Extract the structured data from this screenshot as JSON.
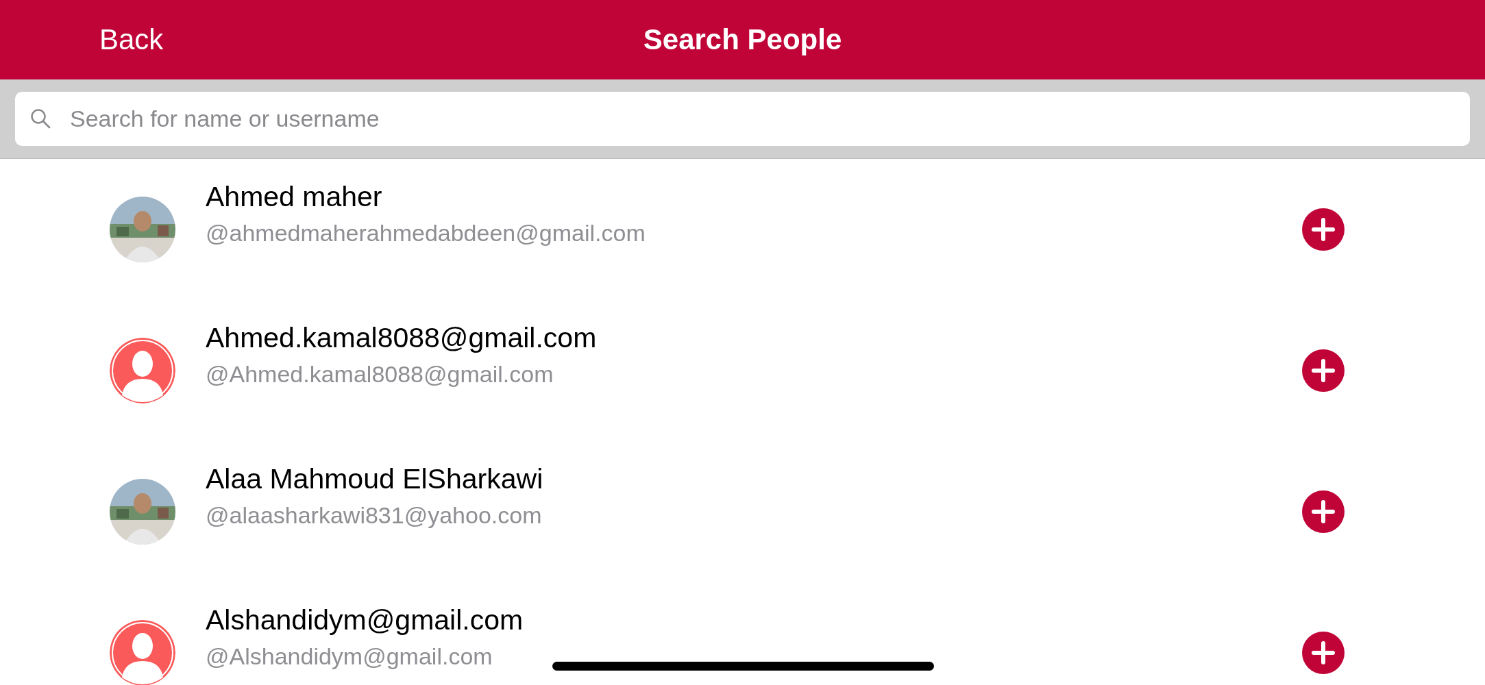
{
  "nav_bar": {
    "back": "Back",
    "title": "Search People"
  },
  "search": {
    "placeholder": "Search for name or username"
  },
  "people": [
    {
      "name": "Ahmed maher",
      "username": "@ahmedmaherahmedabdeen@gmail.com"
    },
    {
      "name": "Ahmed.kamal8088@gmail.com",
      "username": "@Ahmed.kamal8088@gmail.com",
      "avatar": {
        "kind": "default"
      }
    },
    {
      "name": "Alaa Mahmoud ElSharkawi",
      "username": "@alaasharkawi831@yahoo.com"
    },
    {
      "name": "Alshandidym@gmail.com",
      "username": "@Alshandidym@gmail.com",
      "avatar": {
        "kind": "default"
      }
    }
  ]
}
